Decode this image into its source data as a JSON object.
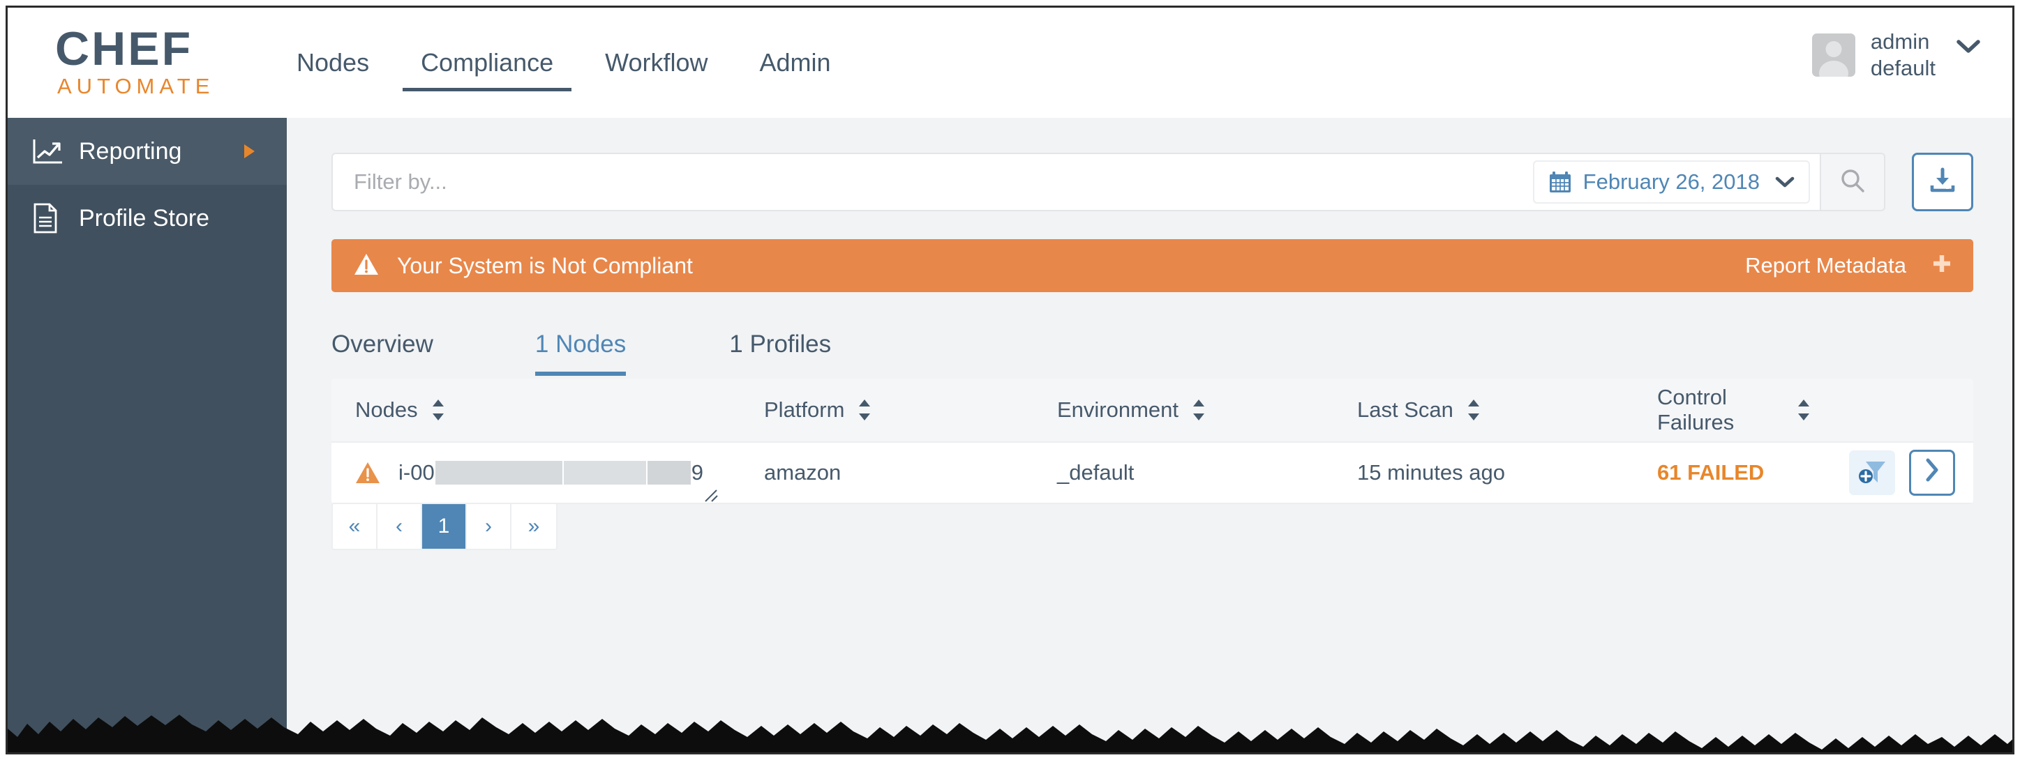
{
  "brand": {
    "name_top": "CHEF",
    "name_bottom": "AUTOMATE"
  },
  "topnav": {
    "items": [
      {
        "label": "Nodes",
        "active": false
      },
      {
        "label": "Compliance",
        "active": true
      },
      {
        "label": "Workflow",
        "active": false
      },
      {
        "label": "Admin",
        "active": false
      }
    ]
  },
  "account": {
    "name": "admin",
    "org": "default",
    "caret": "chevron-down-icon"
  },
  "sidebar": {
    "items": [
      {
        "label": "Reporting",
        "icon": "chart-line-icon",
        "active": true,
        "caret": "triangle-right-icon"
      },
      {
        "label": "Profile Store",
        "icon": "document-icon",
        "active": false
      }
    ]
  },
  "search": {
    "placeholder": "Filter by...",
    "value": "",
    "date_label": "February 26, 2018",
    "calendar_icon": "calendar-icon",
    "search_icon": "search-icon",
    "download_icon": "download-icon"
  },
  "banner": {
    "warning_icon": "warning-triangle-icon",
    "message": "Your System is Not Compliant",
    "action_label": "Report Metadata",
    "plus_icon": "plus-icon",
    "color": "#e8874a"
  },
  "tabs": [
    {
      "label": "Overview",
      "active": false
    },
    {
      "label": "1 Nodes",
      "active": true
    },
    {
      "label": "1 Profiles",
      "active": false
    }
  ],
  "table": {
    "columns": [
      {
        "label": "Nodes",
        "sortable": true
      },
      {
        "label": "Platform",
        "sortable": true
      },
      {
        "label": "Environment",
        "sortable": true
      },
      {
        "label": "Last Scan",
        "sortable": true
      },
      {
        "label": "Control Failures",
        "sortable": true
      }
    ],
    "rows": [
      {
        "status_icon": "warning-triangle-icon",
        "node_prefix": "i-00",
        "node_suffix": "9",
        "platform": "amazon",
        "environment": "_default",
        "last_scan": "15 minutes ago",
        "control_failures": "61 FAILED",
        "add_filter_icon": "add-filter-icon",
        "detail_icon": "chevron-right-icon"
      }
    ]
  },
  "pagination": {
    "first": "«",
    "prev": "‹",
    "pages": [
      {
        "label": "1",
        "active": true
      }
    ],
    "next": "›",
    "last": "»"
  },
  "colors": {
    "brand_dark": "#46596b",
    "brand_orange": "#e8862b",
    "accent_blue": "#4f86b5",
    "sidebar_bg": "#41505e",
    "sidebar_active": "#4a5a68",
    "page_bg": "#f1f3f5",
    "failed_orange": "#e8862b"
  }
}
